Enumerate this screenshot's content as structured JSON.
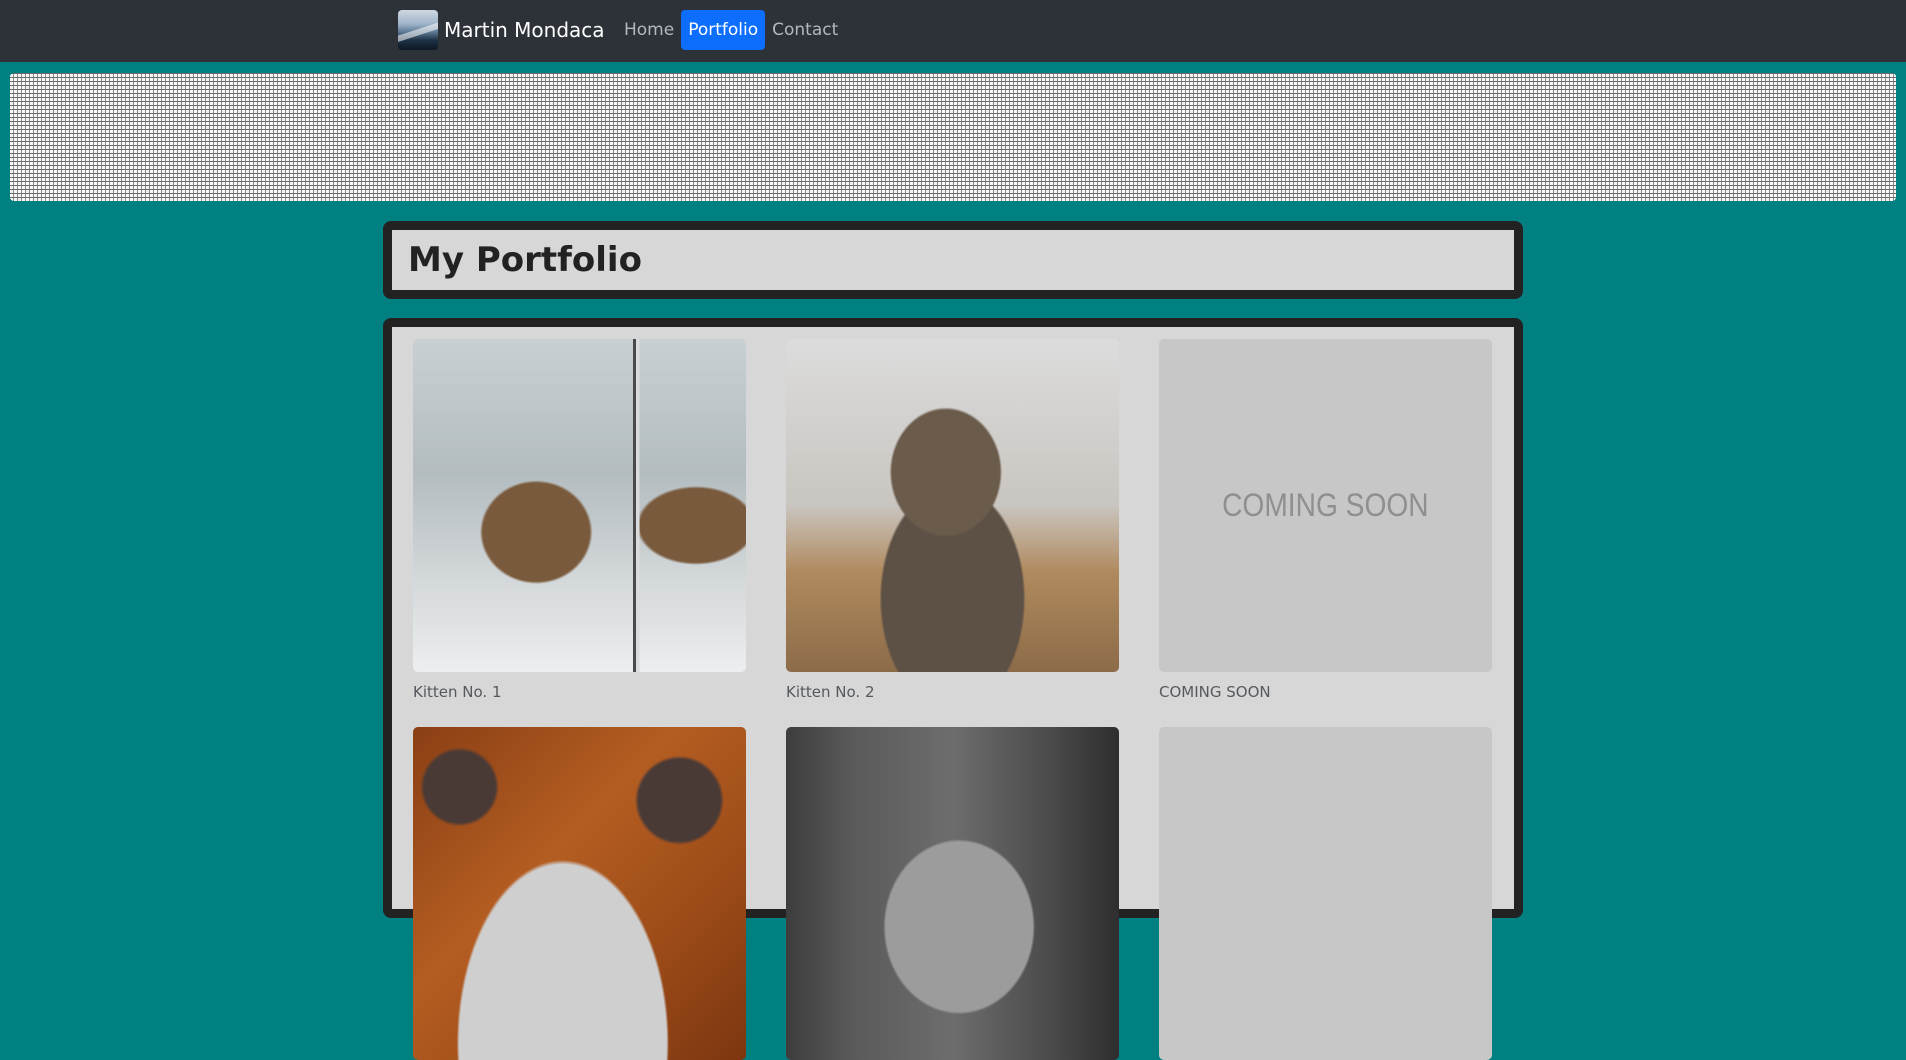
{
  "navbar": {
    "brand_name": "Martin Mondaca",
    "links": [
      {
        "label": "Home",
        "active": false
      },
      {
        "label": "Portfolio",
        "active": true
      },
      {
        "label": "Contact",
        "active": false
      }
    ]
  },
  "page": {
    "title": "My Portfolio"
  },
  "gallery": {
    "items": [
      {
        "caption": "Kitten No. 1"
      },
      {
        "caption": "Kitten No. 2"
      },
      {
        "caption": "COMING SOON",
        "image_text": "COMING SOON"
      },
      {
        "caption": ""
      },
      {
        "caption": ""
      },
      {
        "caption": ""
      }
    ]
  },
  "colors": {
    "page_background": "#008080",
    "navbar_background": "#2d3138",
    "active_link": "#0d6efd",
    "card_background": "#d7d7d7",
    "card_border": "#222222"
  }
}
